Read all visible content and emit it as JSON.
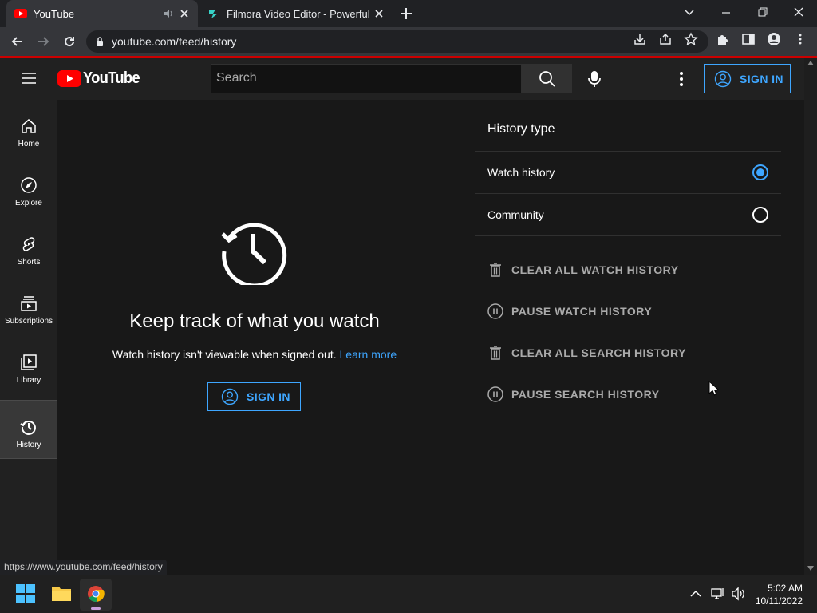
{
  "browser": {
    "tabs": [
      {
        "title": "YouTube"
      },
      {
        "title": "Filmora Video Editor - Powerful V"
      }
    ],
    "url": "youtube.com/feed/history",
    "status_url": "https://www.youtube.com/feed/history"
  },
  "header": {
    "logo_text": "YouTube",
    "search_placeholder": "Search",
    "sign_in": "SIGN IN"
  },
  "guide": {
    "items": [
      {
        "label": "Home"
      },
      {
        "label": "Explore"
      },
      {
        "label": "Shorts"
      },
      {
        "label": "Subscriptions"
      },
      {
        "label": "Library"
      },
      {
        "label": "History"
      }
    ]
  },
  "main": {
    "title": "Keep track of what you watch",
    "subtitle": "Watch history isn't viewable when signed out.",
    "learn_more": "Learn more",
    "sign_in": "SIGN IN"
  },
  "panel": {
    "title": "History type",
    "types": [
      {
        "label": "Watch history",
        "selected": true
      },
      {
        "label": "Community",
        "selected": false
      }
    ],
    "actions": [
      {
        "label": "CLEAR ALL WATCH HISTORY",
        "icon": "trash-icon"
      },
      {
        "label": "PAUSE WATCH HISTORY",
        "icon": "pause-icon"
      },
      {
        "label": "CLEAR ALL SEARCH HISTORY",
        "icon": "trash-icon"
      },
      {
        "label": "PAUSE SEARCH HISTORY",
        "icon": "pause-icon"
      }
    ]
  },
  "taskbar": {
    "time": "5:02 AM",
    "date": "10/11/2022"
  },
  "colors": {
    "accent": "#3ea6ff",
    "brand_red": "#ff0000",
    "background": "#181818"
  }
}
